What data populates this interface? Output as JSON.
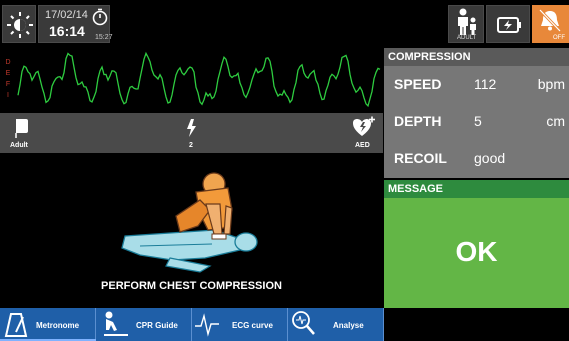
{
  "status": {
    "date": "17/02/14",
    "time": "16:14",
    "timer": "15:27",
    "patient_mode": "ADULT",
    "sound_state": "OFF"
  },
  "ecg": {
    "lead_letters": [
      "D",
      "E",
      "F",
      "I"
    ],
    "trace_color": "#2ecc40"
  },
  "info_strip": {
    "pad_label": "Adult",
    "shock_count": "2",
    "mode_label": "AED"
  },
  "compression": {
    "header": "COMPRESSION",
    "rows": [
      {
        "key": "SPEED",
        "value": "112",
        "unit": "bpm"
      },
      {
        "key": "DEPTH",
        "value": "5",
        "unit": "cm"
      },
      {
        "key": "RECOIL",
        "value": "good",
        "unit": ""
      }
    ]
  },
  "message": {
    "header": "MESSAGE",
    "text": "OK",
    "color": "#63b646"
  },
  "instruction": "PERFORM CHEST COMPRESSION",
  "nav": {
    "tabs": [
      {
        "label": "Metronome",
        "icon": "metronome-icon"
      },
      {
        "label": "CPR Guide",
        "icon": "cpr-guide-icon"
      },
      {
        "label": "ECG curve",
        "icon": "ecg-curve-icon"
      },
      {
        "label": "Analyse",
        "icon": "analyse-icon"
      }
    ]
  },
  "colors": {
    "accent_orange": "#e8883a",
    "nav_blue": "#1f5fa8",
    "message_green": "#63b646"
  }
}
